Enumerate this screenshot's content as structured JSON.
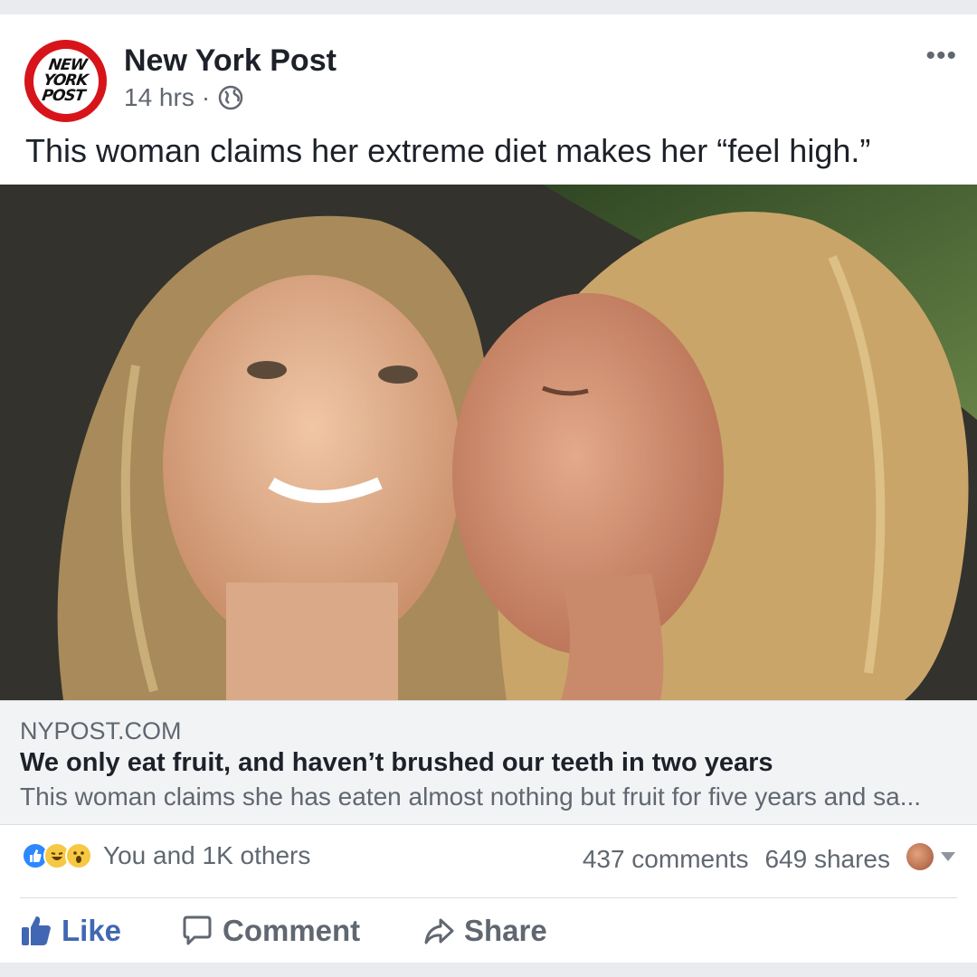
{
  "post": {
    "page_name": "New York Post",
    "logo_text": "NEW YORK POST",
    "time": "14 hrs",
    "separator": "·",
    "privacy_icon": "globe-icon",
    "more_icon": "more-dots-icon",
    "more_label": "•••",
    "caption": "This woman claims her extreme diet makes her “feel high.”"
  },
  "link_preview": {
    "domain": "NYPOST.COM",
    "headline": "We only eat fruit, and haven’t brushed our teeth in two years",
    "description": "This woman claims she has eaten almost nothing but fruit for five years and sa..."
  },
  "stats": {
    "reaction_icons": [
      "like-reaction-icon",
      "haha-reaction-icon",
      "wow-reaction-icon"
    ],
    "reactions_text": "You and 1K others",
    "comments": "437 comments",
    "shares": "649 shares"
  },
  "actions": {
    "like": "Like",
    "comment": "Comment",
    "share": "Share"
  },
  "colors": {
    "brand_blue": "#4267b2",
    "nyp_red": "#d7141a",
    "secondary_text": "#606770"
  }
}
